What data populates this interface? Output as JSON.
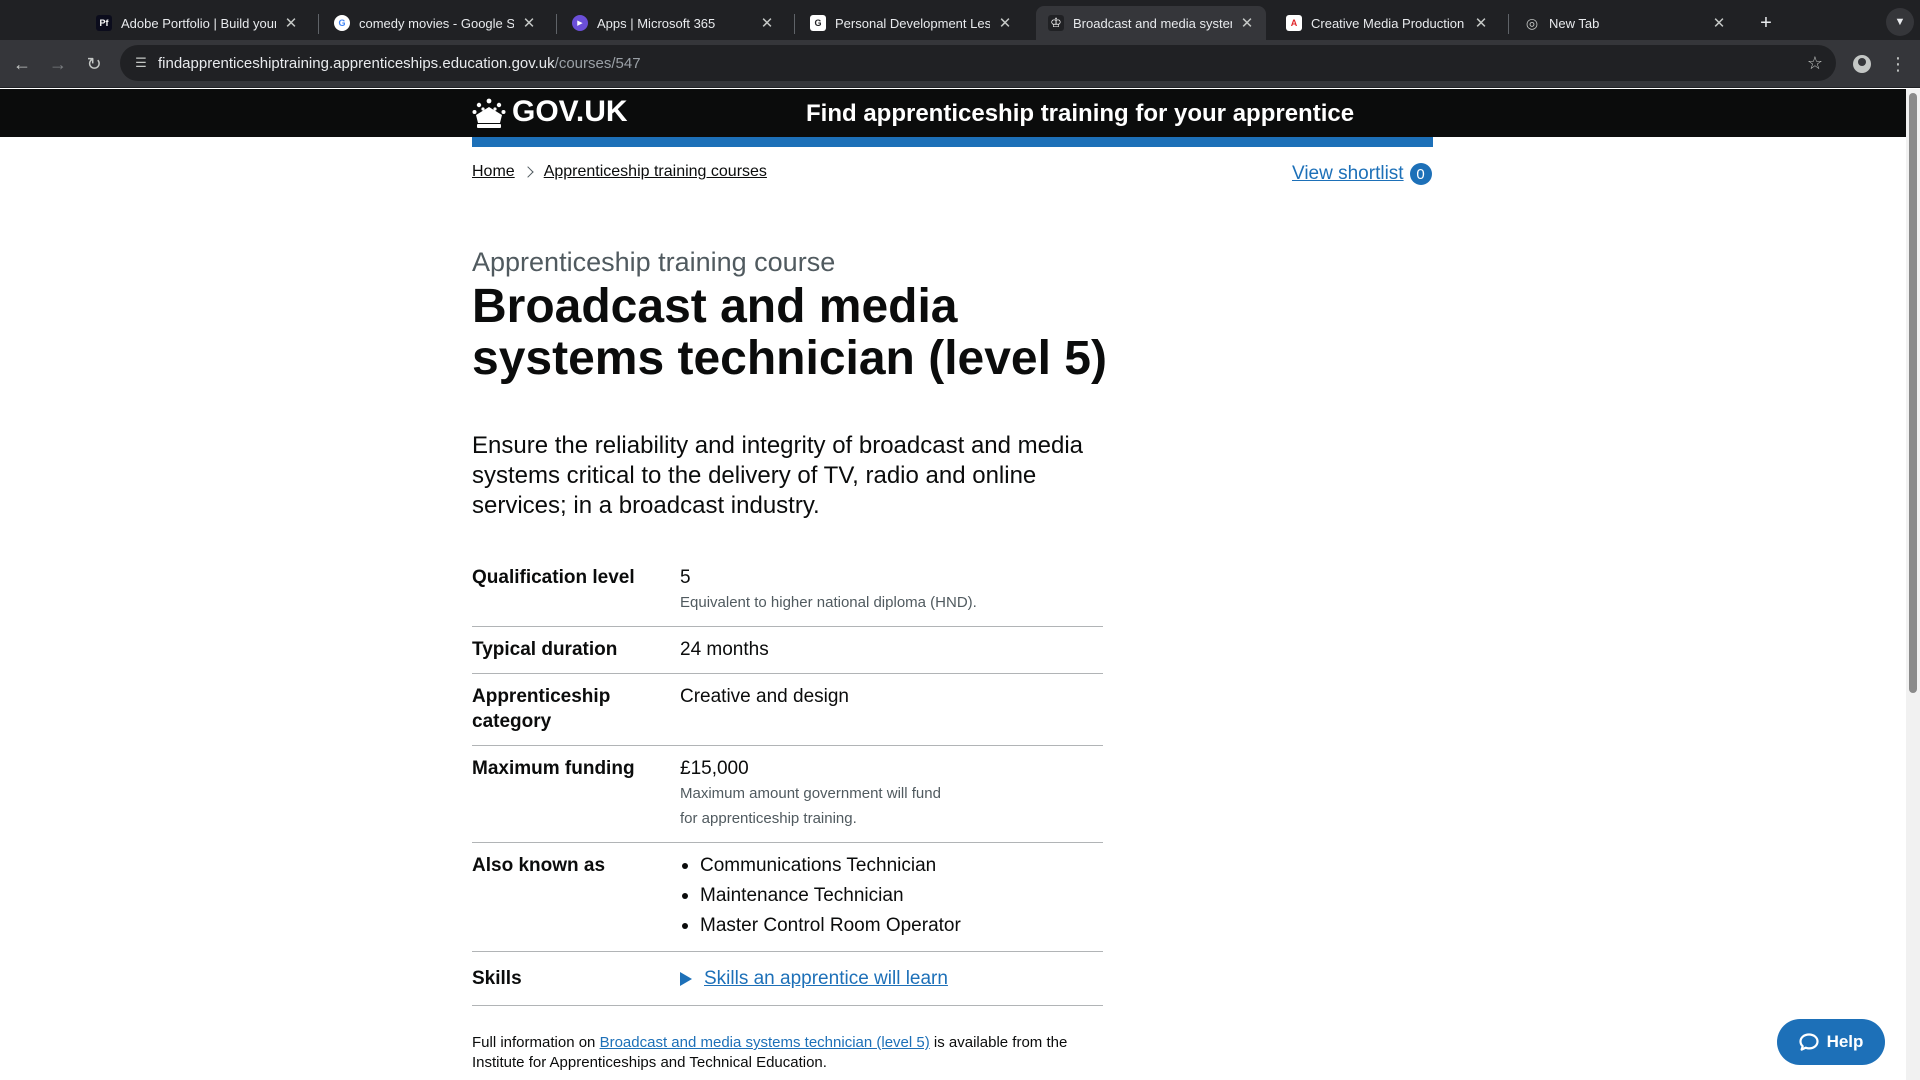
{
  "browser": {
    "tabs": [
      {
        "title": "Adobe Portfolio | Build your o",
        "favicon": "Pf",
        "favicon_bg": "#0b0c1c",
        "favicon_fg": "#ffffff",
        "active": false
      },
      {
        "title": "comedy movies - Google Sea",
        "favicon": "G",
        "favicon_bg": "#ffffff",
        "favicon_fg": "#4285f4",
        "active": false
      },
      {
        "title": "Apps | Microsoft 365",
        "favicon": "▶",
        "favicon_bg": "#6b4fd8",
        "favicon_fg": "#ffffff",
        "active": false
      },
      {
        "title": "Personal Development Lesso",
        "favicon": "G",
        "favicon_bg": "#ffffff",
        "favicon_fg": "#202124",
        "active": false
      },
      {
        "title": "Broadcast and media system",
        "favicon": "♔",
        "favicon_bg": "#202124",
        "favicon_fg": "#ffffff",
        "active": true
      },
      {
        "title": "Creative Media Production (G",
        "favicon": "A",
        "favicon_bg": "#ffffff",
        "favicon_fg": "#e0262a",
        "active": false
      },
      {
        "title": "New Tab",
        "favicon": "◎",
        "favicon_bg": "#35363a",
        "favicon_fg": "#c4c7c5",
        "active": false
      }
    ],
    "url_host": "findapprenticeshiptraining.apprenticeships.education.gov.uk",
    "url_path": "/courses/547"
  },
  "header": {
    "logo_text": "GOV.UK",
    "service_name": "Find apprenticeship training for your apprentice"
  },
  "breadcrumb": {
    "home": "Home",
    "courses": "Apprenticeship training courses"
  },
  "shortlist": {
    "label": "View shortlist",
    "count": "0"
  },
  "course": {
    "caption": "Apprenticeship training course",
    "title": "Broadcast and media systems technician (level 5)",
    "lead": "Ensure the reliability and integrity of broadcast and media systems critical to the delivery of TV, radio and online services; in a broadcast industry."
  },
  "summary": {
    "qualification_level": {
      "key": "Qualification level",
      "value": "5",
      "hint": "Equivalent to higher national diploma (HND)."
    },
    "typical_duration": {
      "key": "Typical duration",
      "value": "24 months"
    },
    "category": {
      "key": "Apprenticeship category",
      "value": "Creative and design"
    },
    "funding": {
      "key": "Maximum funding",
      "value": "£15,000",
      "hint_line1": "Maximum amount government will fund",
      "hint_line2": "for apprenticeship training."
    },
    "also_known_as": {
      "key": "Also known as",
      "items": [
        "Communications Technician",
        "Maintenance Technician",
        "Master Control Room Operator"
      ]
    },
    "skills": {
      "key": "Skills",
      "link": "Skills an apprentice will learn"
    }
  },
  "full_info": {
    "prefix": "Full information on",
    "link": "Broadcast and media systems technician (level 5)",
    "suffix": "is available from the Institute for Apprenticeships and Technical Education."
  },
  "help": {
    "label": "Help"
  }
}
